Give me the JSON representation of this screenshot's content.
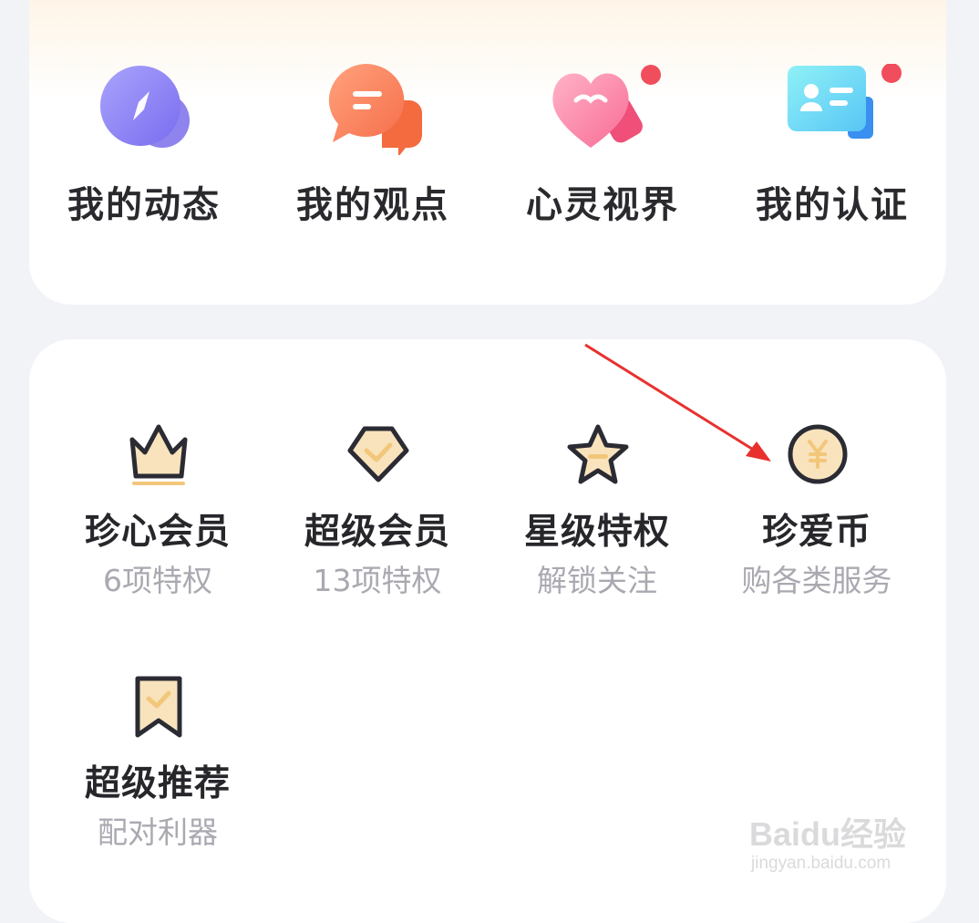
{
  "top_menu": [
    {
      "label": "我的动态",
      "icon": "compass-icon",
      "has_red_dot": false
    },
    {
      "label": "我的观点",
      "icon": "chat-bubble-icon",
      "has_red_dot": false
    },
    {
      "label": "心灵视界",
      "icon": "heart-icon",
      "has_red_dot": true
    },
    {
      "label": "我的认证",
      "icon": "id-card-icon",
      "has_red_dot": true
    }
  ],
  "services": [
    {
      "title": "珍心会员",
      "subtitle": "6项特权",
      "icon": "crown-icon"
    },
    {
      "title": "超级会员",
      "subtitle": "13项特权",
      "icon": "diamond-icon"
    },
    {
      "title": "星级特权",
      "subtitle": "解锁关注",
      "icon": "star-icon"
    },
    {
      "title": "珍爱币",
      "subtitle": "购各类服务",
      "icon": "coin-icon"
    },
    {
      "title": "超级推荐",
      "subtitle": "配对利器",
      "icon": "bookmark-icon"
    }
  ],
  "watermark": {
    "brand": "Baidu经验",
    "url": "jingyan.baidu.com"
  },
  "colors": {
    "red_dot": "#f04e5c",
    "icon_outline": "#2b2b33",
    "icon_fill": "#f8e3bd",
    "arrow": "#e8312e"
  }
}
